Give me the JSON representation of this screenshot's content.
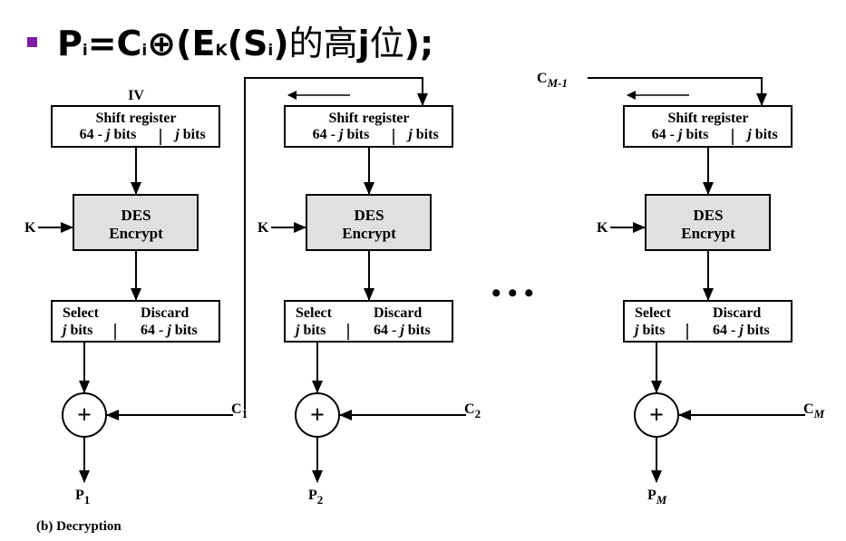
{
  "title": {
    "p": "P",
    "p_sub": "i",
    "eq": "=",
    "c": "C",
    "c_sub": "i",
    "xor": "⊕",
    "open": "(",
    "e": "E",
    "e_sub": "K",
    "open2": "(",
    "s": "S",
    "s_sub": "i",
    "close2": ")",
    "de": "的",
    "gao": "高",
    "j": "j",
    "wei": "位",
    "close": ");"
  },
  "stages": [
    {
      "feedback_in": "IV",
      "shift_title": "Shift register",
      "shift_left": "64 - j bits",
      "shift_right": "j bits",
      "des_line1": "DES",
      "des_line2": "Encrypt",
      "key": "K",
      "select_label": "Select",
      "select_bits": "j bits",
      "discard_label": "Discard",
      "discard_bits": "64 - j bits",
      "xor_symbol": "+",
      "cipher_in": "C1",
      "plain_out": "P1"
    },
    {
      "feedback_in": "",
      "shift_title": "Shift register",
      "shift_left": "64 - j bits",
      "shift_right": "j bits",
      "des_line1": "DES",
      "des_line2": "Encrypt",
      "key": "K",
      "select_label": "Select",
      "select_bits": "j bits",
      "discard_label": "Discard",
      "discard_bits": "64 - j bits",
      "xor_symbol": "+",
      "cipher_in": "C2",
      "plain_out": "P2"
    },
    {
      "feedback_in": "CM-1",
      "shift_title": "Shift register",
      "shift_left": "64 - j bits",
      "shift_right": "j bits",
      "des_line1": "DES",
      "des_line2": "Encrypt",
      "key": "K",
      "select_label": "Select",
      "select_bits": "j bits",
      "discard_label": "Discard",
      "discard_bits": "64 - j bits",
      "xor_symbol": "+",
      "cipher_in": "CM",
      "plain_out": "PM"
    }
  ],
  "ellipsis": "• • •",
  "caption": "(b) Decryption",
  "colors": {
    "bullet": "#7b1fa2",
    "des_fill": "#e0e0e0"
  }
}
